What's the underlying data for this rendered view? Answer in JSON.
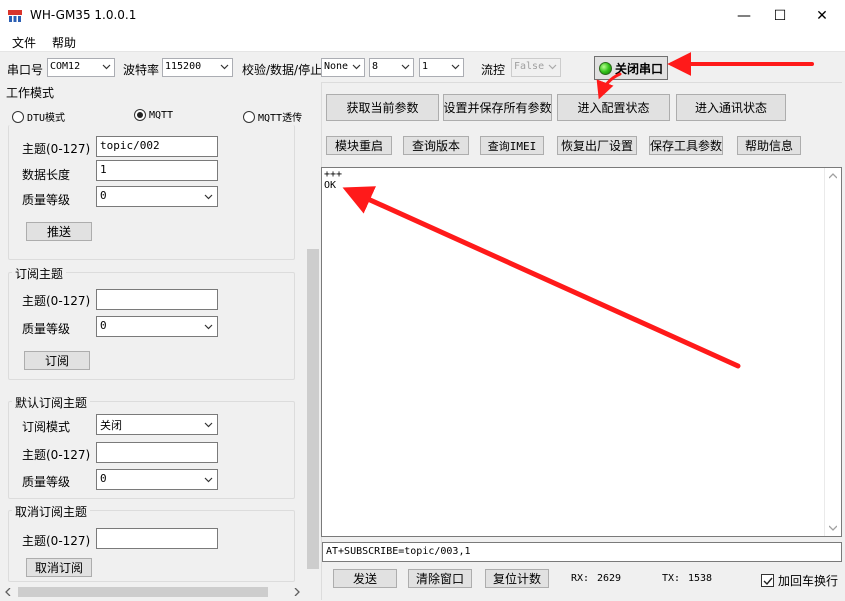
{
  "window": {
    "title": "WH-GM35 1.0.0.1",
    "minimize_glyph": "—",
    "maximize_glyph": "☐",
    "close_glyph": "✕"
  },
  "menu": {
    "file": "文件",
    "help": "帮助"
  },
  "toolbar": {
    "port_label": "串口号",
    "port_value": "COM12",
    "baud_label": "波特率",
    "baud_value": "115200",
    "parity_label": "校验/数据/停止",
    "parity_value": "None",
    "data_bits_value": "8",
    "stop_bits_value": "1",
    "flow_label": "流控",
    "flow_value": "False",
    "close_port_label": "关闭串口"
  },
  "work_mode": {
    "title": "工作模式",
    "options": [
      "DTU模式",
      "MQTT",
      "MQTT透传"
    ],
    "selected": "MQTT"
  },
  "publish": {
    "topic_label": "主题(0-127)",
    "topic_value": "topic/002",
    "length_label": "数据长度",
    "length_value": "1",
    "qos_label": "质量等级",
    "qos_value": "0",
    "push_button": "推送"
  },
  "subscribe": {
    "title": "订阅主题",
    "topic_label": "主题(0-127)",
    "topic_value": "",
    "qos_label": "质量等级",
    "qos_value": "0",
    "subscribe_button": "订阅"
  },
  "default_subscribe": {
    "title": "默认订阅主题",
    "mode_label": "订阅模式",
    "mode_value": "关闭",
    "topic_label": "主题(0-127)",
    "topic_value": "",
    "qos_label": "质量等级",
    "qos_value": "0"
  },
  "unsubscribe": {
    "title": "取消订阅主题",
    "topic_label": "主题(0-127)",
    "topic_value": "",
    "button": "取消订阅"
  },
  "actions_row1": [
    "获取当前参数",
    "设置并保存所有参数",
    "进入配置状态",
    "进入通讯状态"
  ],
  "actions_row2": [
    "模块重启",
    "查询版本",
    "查询IMEI",
    "恢复出厂设置",
    "保存工具参数",
    "帮助信息"
  ],
  "terminal": {
    "lines": "+++\nOK"
  },
  "command": {
    "value": "AT+SUBSCRIBE=topic/003,1"
  },
  "bottom": {
    "send": "发送",
    "clear": "清除窗口",
    "reset_count": "复位计数",
    "rx_label": "RX:",
    "rx_value": "2629",
    "tx_label": "TX:",
    "tx_value": "1538",
    "append_crlf": "加回车换行",
    "append_crlf_checked": true
  },
  "colors": {
    "annotation_arrow": "#ff1a1a",
    "led": "#33c21b"
  }
}
